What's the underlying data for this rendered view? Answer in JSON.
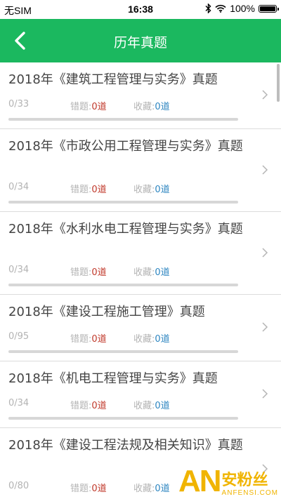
{
  "status_bar": {
    "carrier": "无SIM",
    "time": "16:38",
    "battery": "100%"
  },
  "header": {
    "title": "历年真题",
    "back_icon": "chevron-left-icon"
  },
  "labels": {
    "wrong": "错题:",
    "favorite": "收藏:"
  },
  "items": [
    {
      "title": "2018年《建筑工程管理与实务》真题",
      "progress": "0/33",
      "wrong": "0道",
      "favorite": "0道",
      "progress_fraction": 0
    },
    {
      "title": "2018年《市政公用工程管理与实务》真题",
      "progress": "0/34",
      "wrong": "0道",
      "favorite": "0道",
      "progress_fraction": 0
    },
    {
      "title": "2018年《水利水电工程管理与实务》真题",
      "progress": "0/34",
      "wrong": "0道",
      "favorite": "0道",
      "progress_fraction": 0
    },
    {
      "title": "2018年《建设工程施工管理》真题",
      "progress": "0/95",
      "wrong": "0道",
      "favorite": "0道",
      "progress_fraction": 0
    },
    {
      "title": "2018年《机电工程管理与实务》真题",
      "progress": "0/34",
      "wrong": "0道",
      "favorite": "0道",
      "progress_fraction": 0
    },
    {
      "title": "2018年《建设工程法规及相关知识》真题",
      "progress": "0/80",
      "wrong": "0道",
      "favorite": "0道",
      "progress_fraction": 0
    }
  ],
  "watermark": {
    "logo": "AN",
    "name_cn": "安粉丝",
    "name_en": "ANFENSI.COM"
  },
  "colors": {
    "accent": "#1bb85f",
    "wrong_count": "#c0392b",
    "favorite_count": "#2e86c1"
  }
}
